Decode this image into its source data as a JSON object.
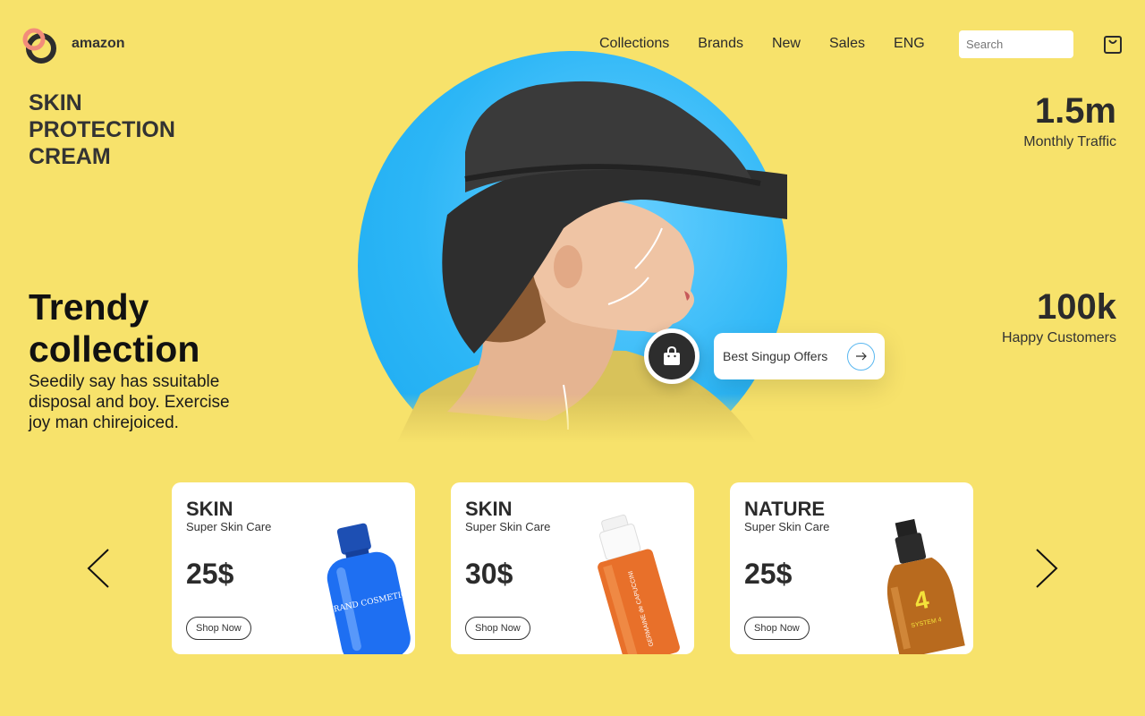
{
  "header": {
    "brand": "amazon",
    "nav": [
      "Collections",
      "Brands",
      "New",
      "Sales",
      "ENG"
    ],
    "search_placeholder": "Search"
  },
  "hero": {
    "headline_lines": [
      "SKIN",
      "PROTECTION",
      "CREAM"
    ],
    "trendy_lines": [
      "Trendy",
      "collection"
    ],
    "description": "Seedily say has ssuitable disposal and boy. Exercise joy man chirejoiced.",
    "offer_label": "Best Singup Offers"
  },
  "stats": [
    {
      "value": "1.5m",
      "label": "Monthly Traffic"
    },
    {
      "value": "100k",
      "label": "Happy Customers"
    }
  ],
  "products": [
    {
      "title": "SKIN",
      "subtitle": "Super Skin Care",
      "price": "25$",
      "button": "Shop Now",
      "bottle_label": "BRAND COSMETICS"
    },
    {
      "title": "SKIN",
      "subtitle": "Super Skin Care",
      "price": "30$",
      "button": "Shop Now",
      "bottle_label": "GERMAINE de CAPUCCINI"
    },
    {
      "title": "NATURE",
      "subtitle": "Super Skin Care",
      "price": "25$",
      "button": "Shop Now",
      "bottle_label": "SYSTEM 4"
    }
  ],
  "colors": {
    "background": "#f7e26b",
    "hero_circle": "#2cb6f6",
    "logo_accent": "#f28c7a",
    "dark": "#2d2d2d"
  },
  "icons": [
    "logo-rings-icon",
    "cart-icon",
    "bag-icon",
    "arrow-right-icon",
    "chevron-left-icon",
    "chevron-right-icon"
  ]
}
